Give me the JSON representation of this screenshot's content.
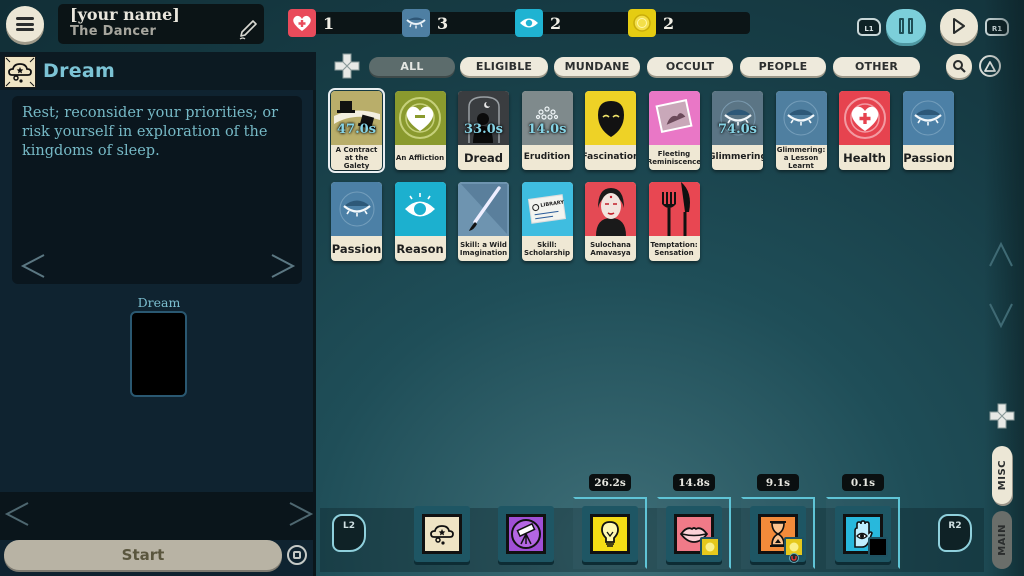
{
  "header": {
    "menu_icon": "hamburger-menu-icon",
    "player_name": "[your name]",
    "player_title": "The Dancer",
    "edit_icon": "pencil-icon"
  },
  "aspects": [
    {
      "name": "Health",
      "icon": "health-heart-icon",
      "count": "1",
      "color": "#e94b5b"
    },
    {
      "name": "Passion",
      "icon": "closed-eye-icon",
      "count": "3",
      "color": "#4e7fa3"
    },
    {
      "name": "Reason",
      "icon": "open-eye-icon",
      "count": "2",
      "color": "#1fb3d2"
    },
    {
      "name": "Funds",
      "icon": "coin-icon",
      "count": "2",
      "color": "#e5cc12"
    }
  ],
  "controls": {
    "l1": "L1",
    "r1": "R1",
    "pause_icon": "pause-icon",
    "play_icon": "play-icon",
    "search_icon": "search-icon",
    "triangle_icon": "triangle-button-icon"
  },
  "filters": [
    {
      "label": "ALL",
      "active": true
    },
    {
      "label": "ELIGIBLE",
      "active": false
    },
    {
      "label": "MUNDANE",
      "active": false
    },
    {
      "label": "OCCULT",
      "active": false
    },
    {
      "label": "PEOPLE",
      "active": false
    },
    {
      "label": "OTHER",
      "active": false
    }
  ],
  "cards": [
    {
      "label": "A Contract at the Galety",
      "timer": "47.0s",
      "art": "top-hats",
      "bg": "#b9ae6a",
      "selected": true
    },
    {
      "label": "An Affliction",
      "timer": "",
      "art": "heart-minus",
      "bg": "#8a9a2e"
    },
    {
      "label": "Dread",
      "timer": "33.0s",
      "art": "shadow-figure",
      "bg": "#3a3d40"
    },
    {
      "label": "Erudition",
      "timer": "14.0s",
      "art": "mind-dots",
      "bg": "#7f8a8c"
    },
    {
      "label": "Fascination",
      "timer": "",
      "art": "black-mask",
      "bg": "#eed226"
    },
    {
      "label": "Fleeting Reminiscence",
      "timer": "",
      "art": "photograph",
      "bg": "#e977c6"
    },
    {
      "label": "Glimmering",
      "timer": "74.0s",
      "art": "closed-eye",
      "bg": "#5b7585"
    },
    {
      "label": "Glimmering: a Lesson Learnt",
      "timer": "",
      "art": "closed-eye",
      "bg": "#4f7fa0"
    },
    {
      "label": "Health",
      "timer": "",
      "art": "health-heart",
      "bg": "#e6434f"
    },
    {
      "label": "Passion",
      "timer": "",
      "art": "closed-eye",
      "bg": "#4c80a6"
    },
    {
      "label": "Passion",
      "timer": "",
      "art": "closed-eye",
      "bg": "#4c80a6"
    },
    {
      "label": "Reason",
      "timer": "",
      "art": "open-eye",
      "bg": "#1cb0cf"
    },
    {
      "label": "Skill: a Wild Imagination",
      "timer": "",
      "art": "paintbrush",
      "bg": "#6e94b0"
    },
    {
      "label": "Skill: Scholarship",
      "timer": "",
      "art": "library-card",
      "bg": "#3fbde0"
    },
    {
      "label": "Sulochana Amavasya",
      "timer": "",
      "art": "portrait",
      "bg": "#e44a54"
    },
    {
      "label": "Temptation: Sensation",
      "timer": "",
      "art": "fork-knife",
      "bg": "#e84752"
    }
  ],
  "situation": {
    "verb_icon": "dream-cloud-icon",
    "title": "Dream",
    "description": "Rest; reconsider your priorities; or risk yourself in exploration of the kingdoms of sleep.",
    "slot_label": "Dream",
    "prev_icon": "chevron-left-icon",
    "next_icon": "chevron-right-icon",
    "start_label": "Start",
    "square_icon": "square-button-icon"
  },
  "side_tabs": {
    "up_icon": "chevron-up-icon",
    "down_icon": "chevron-down-icon",
    "misc": "MISC",
    "main": "MAIN"
  },
  "verbs": {
    "l2": "L2",
    "r2": "R2",
    "items": [
      {
        "name": "Dream",
        "icon": "dream-cloud-icon",
        "color": "#efe4c4",
        "timer": ""
      },
      {
        "name": "Study",
        "icon": "telescope-icon",
        "color": "#a04fd6",
        "timer": ""
      },
      {
        "name": "Idea",
        "icon": "lightbulb-icon",
        "color": "#f4dc15",
        "timer": "26.2s"
      },
      {
        "name": "Talk",
        "icon": "lips-icon",
        "color": "#f07a88",
        "timer": "14.8s"
      },
      {
        "name": "Time",
        "icon": "hourglass-icon",
        "color": "#f38b3a",
        "timer": "9.1s"
      },
      {
        "name": "Explore",
        "icon": "hand-eye-icon",
        "color": "#28b8dc",
        "timer": "0.1s"
      }
    ]
  }
}
